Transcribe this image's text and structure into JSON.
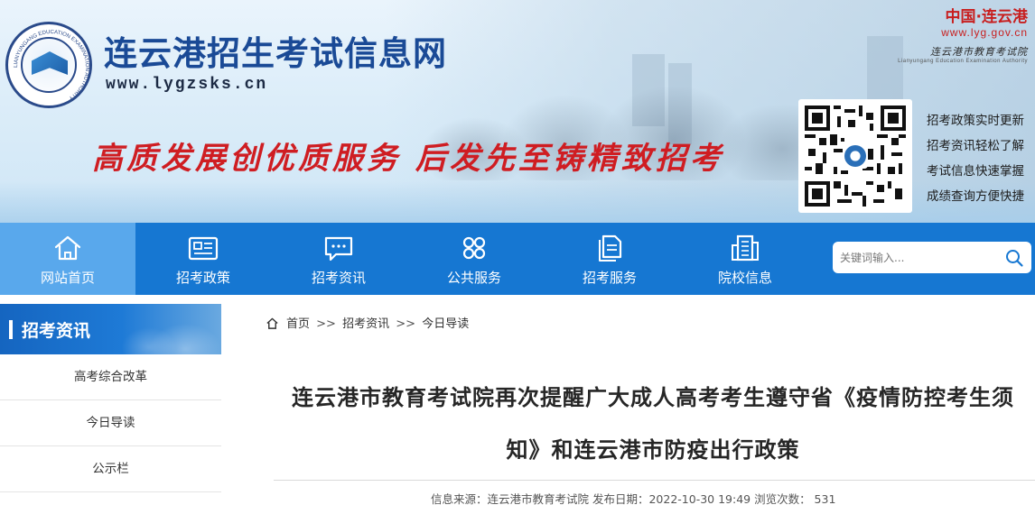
{
  "header": {
    "site_title": "连云港招生考试信息网",
    "site_url": "www.lygzsks.cn",
    "slogan": "高质发展创优质服务 后发先至铸精致招考",
    "seal_text": "LIANYUNGANG EDUCATION EXAMINATION AUTHORITY",
    "seal_cn": "连云港市教育考试院",
    "gov_brand": {
      "name": "中国·连云港",
      "url": "www.lyg.gov.cn",
      "calligraphy": "连云港市教育考试院",
      "english": "Lianyungang Education Examination Authority"
    },
    "qr_features": [
      "招考政策实时更新",
      "招考资讯轻松了解",
      "考试信息快速掌握",
      "成绩查询方便快捷"
    ]
  },
  "nav": {
    "items": [
      {
        "label": "网站首页",
        "icon": "home-icon",
        "active": true
      },
      {
        "label": "招考政策",
        "icon": "newspaper-icon"
      },
      {
        "label": "招考资讯",
        "icon": "chat-icon"
      },
      {
        "label": "公共服务",
        "icon": "grid-icon"
      },
      {
        "label": "招考服务",
        "icon": "document-icon"
      },
      {
        "label": "院校信息",
        "icon": "building-icon"
      }
    ],
    "search_placeholder": "关键词输入..."
  },
  "sidebar": {
    "title": "招考资讯",
    "items": [
      {
        "label": "高考综合改革"
      },
      {
        "label": "今日导读"
      },
      {
        "label": "公示栏"
      }
    ]
  },
  "breadcrumb": {
    "items": [
      "首页",
      "招考资讯",
      "今日导读"
    ],
    "separator": ">>"
  },
  "article": {
    "title_line1": "连云港市教育考试院再次提醒广大成人高考考生遵守省《疫情防控考生须",
    "title_line2": "知》和连云港市防疫出行政策",
    "meta": "信息来源：连云港市教育考试院 发布日期：2022-10-30 19:49 浏览次数： 531"
  },
  "colors": {
    "nav_blue": "#1677d2",
    "nav_active": "#59a8ec",
    "title_blue": "#1a4a96",
    "slogan_red": "#cf1d22"
  }
}
